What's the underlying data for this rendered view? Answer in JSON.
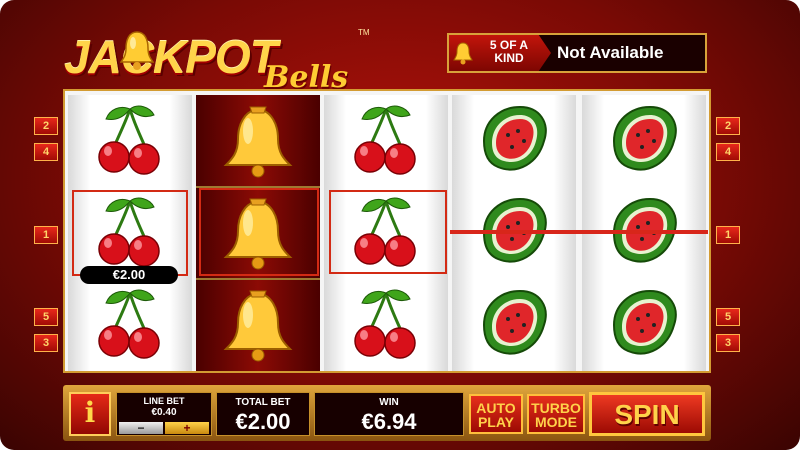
{
  "logo": {
    "word": "JACKPOT",
    "script": "Bells",
    "trademark": "TM",
    "icon": "bell-icon"
  },
  "banner": {
    "tag": "5 OF A KIND",
    "status": "Not Available",
    "icon": "bell-icon"
  },
  "reels": [
    [
      "cherries",
      "cherries",
      "cherries"
    ],
    [
      "bell",
      "bell",
      "bell"
    ],
    [
      "cherries",
      "cherries",
      "cherries"
    ],
    [
      "watermelon",
      "watermelon",
      "watermelon"
    ],
    [
      "watermelon",
      "watermelon",
      "watermelon"
    ]
  ],
  "win_amount_label": "€2.00",
  "line_markers": {
    "left": [
      "2",
      "4",
      "1",
      "5",
      "3"
    ],
    "right": [
      "2",
      "4",
      "1",
      "5",
      "3"
    ]
  },
  "controls": {
    "info": "i",
    "line_bet_label": "LINE BET",
    "line_bet_value": "€0.40",
    "minus": "−",
    "plus": "+",
    "total_bet_label": "TOTAL BET",
    "total_bet_value": "€2.00",
    "win_label": "WIN",
    "win_value": "€6.94",
    "autoplay_line1": "AUTO",
    "autoplay_line2": "PLAY",
    "turbo_line1": "TURBO",
    "turbo_line2": "MODE",
    "spin": "SPIN"
  },
  "colors": {
    "accent": "#d8a23a",
    "background": "#8c0b05",
    "win_line": "#d8261a"
  }
}
